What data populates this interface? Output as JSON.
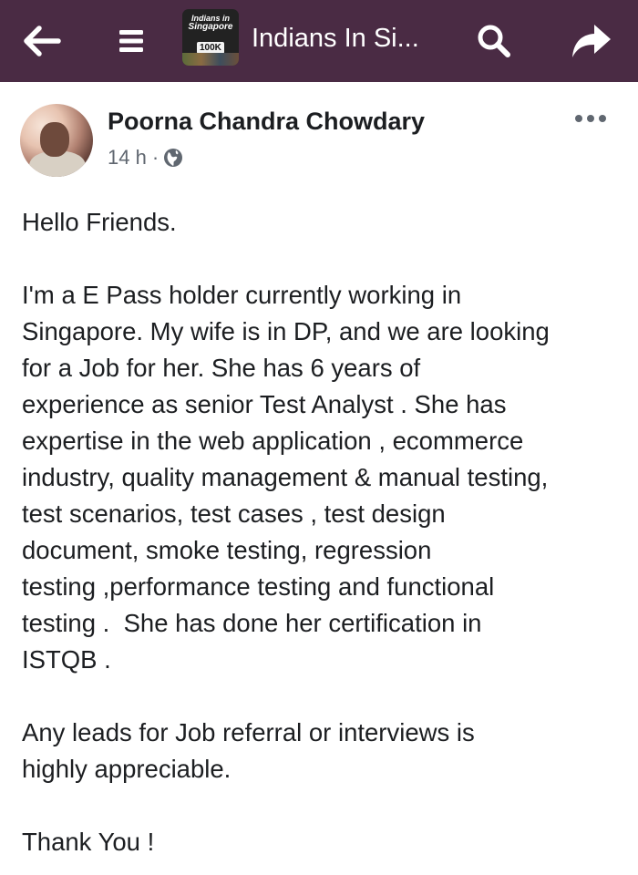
{
  "topbar": {
    "back_icon": "arrow-left-icon",
    "menu_icon": "hamburger-menu-icon",
    "group_logo": {
      "line1": "Indians in",
      "line2": "Singapore",
      "badge": "100K"
    },
    "group_name": "Indians In Si...",
    "search_icon": "search-icon",
    "share_icon": "share-arrow-icon",
    "background_color": "#4a2b44"
  },
  "post": {
    "author": "Poorna Chandra Chowdary",
    "time": "14 h",
    "separator": "·",
    "privacy_icon": "globe-icon",
    "more_icon": "more-options-icon",
    "lines": [
      "Hello Friends.",
      "",
      "I'm a E Pass holder currently working in",
      "Singapore. My wife is in DP, and we are looking",
      "for a Job for her. She has 6 years of",
      "experience as senior Test Analyst . She has",
      "expertise in the web application , ecommerce",
      "industry, quality management & manual testing,",
      "test scenarios, test cases , test design",
      "document, smoke testing, regression",
      "testing ,performance testing and functional",
      "testing .  She has done her certification in",
      "ISTQB .",
      "",
      "Any leads for Job referral or interviews is",
      "highly appreciable.",
      "",
      "Thank You !"
    ]
  }
}
